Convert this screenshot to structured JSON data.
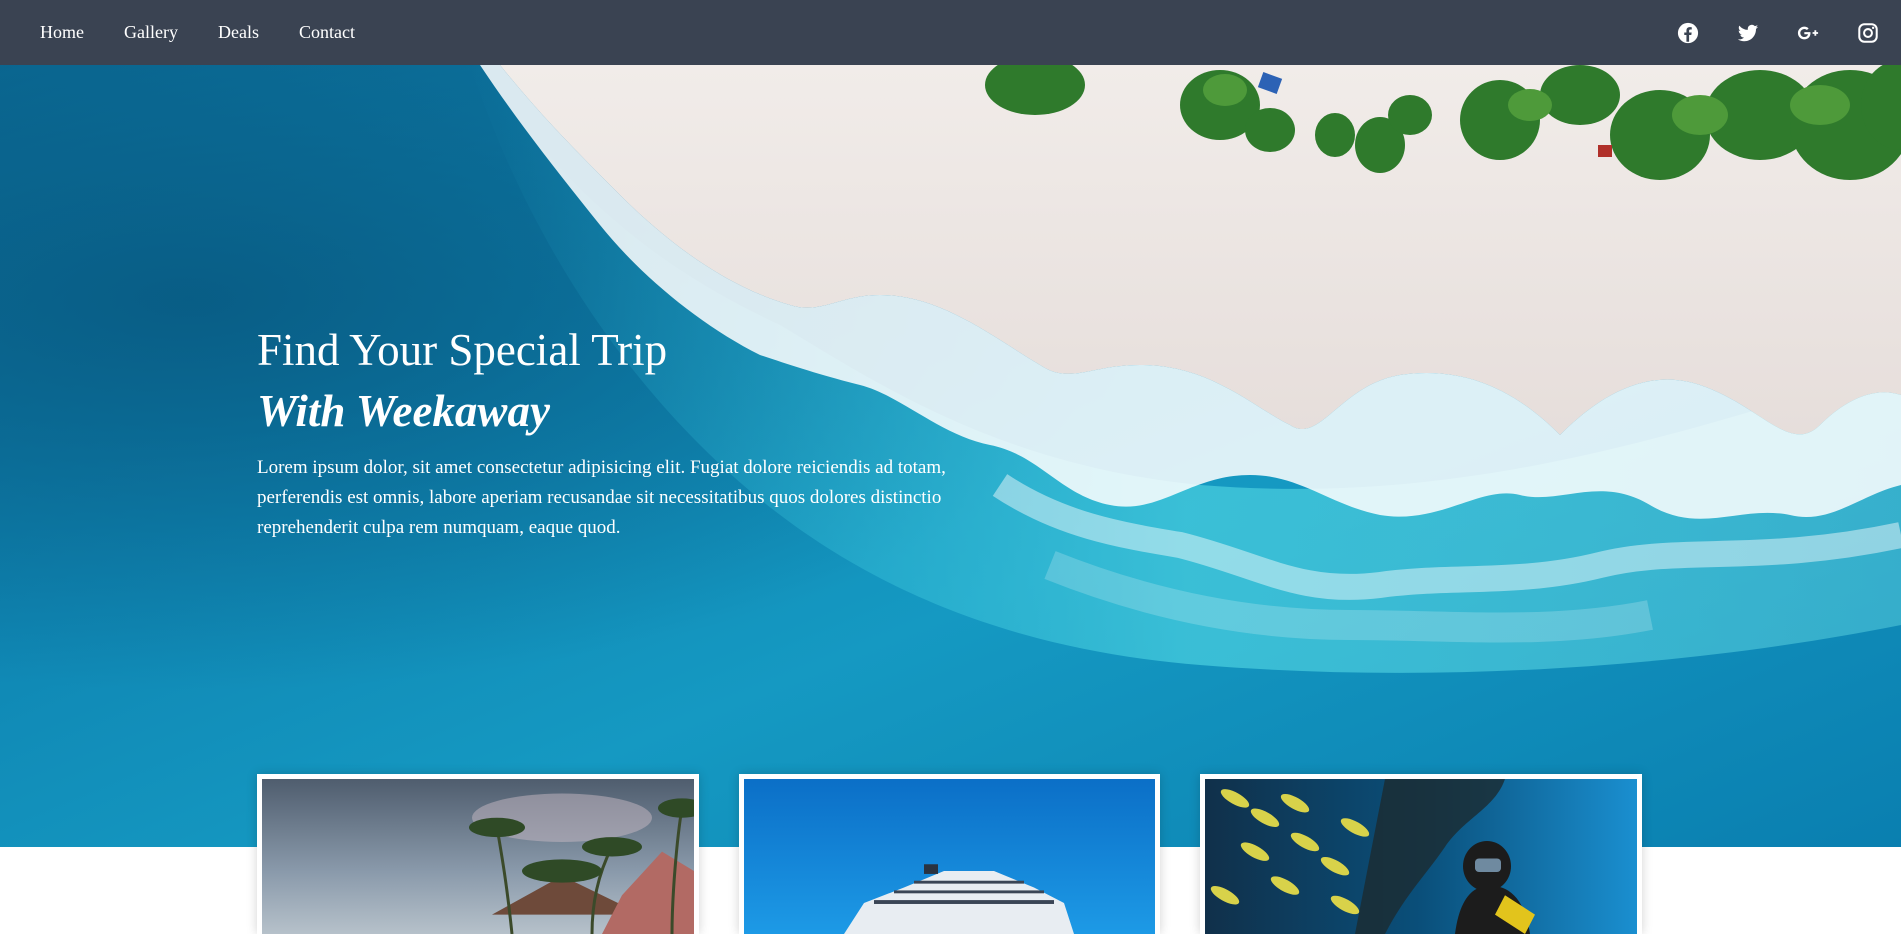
{
  "nav": {
    "items": [
      {
        "label": "Home"
      },
      {
        "label": "Gallery"
      },
      {
        "label": "Deals"
      },
      {
        "label": "Contact"
      }
    ],
    "social": [
      {
        "icon": "facebook-icon"
      },
      {
        "icon": "twitter-icon"
      },
      {
        "icon": "google-plus-icon"
      },
      {
        "icon": "instagram-icon"
      }
    ]
  },
  "hero": {
    "title": "Find Your Special Trip",
    "subtitle": "With Weekaway",
    "text": "Lorem ipsum dolor, sit amet consectetur adipisicing elit. Fugiat dolore reiciendis ad totam, perferendis est omnis, labore aperiam recusandae sit necessitatibus quos dolores distinctio reprehenderit culpa rem numquam, eaque quod."
  },
  "cards": [
    {
      "image": "tropical-resort-photo"
    },
    {
      "image": "cruise-ship-photo"
    },
    {
      "image": "scuba-diver-photo"
    }
  ],
  "colors": {
    "navbar": "#3a4352",
    "text": "#ffffff",
    "ocean": "#0c6f9e",
    "sand": "#ece6e2"
  }
}
